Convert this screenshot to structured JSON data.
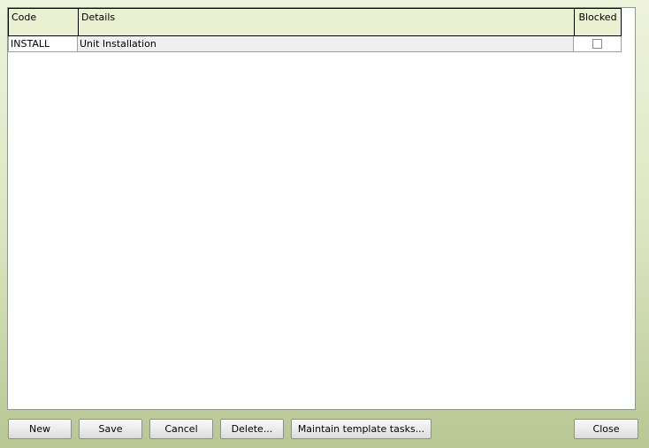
{
  "grid": {
    "columns": {
      "code": "Code",
      "details": "Details",
      "blocked": "Blocked"
    },
    "rows": [
      {
        "code": "INSTALL",
        "details": "Unit Installation",
        "blocked": false
      }
    ]
  },
  "buttons": {
    "new": "New",
    "save": "Save",
    "cancel": "Cancel",
    "delete": "Delete...",
    "maintain": "Maintain template tasks...",
    "close": "Close"
  }
}
